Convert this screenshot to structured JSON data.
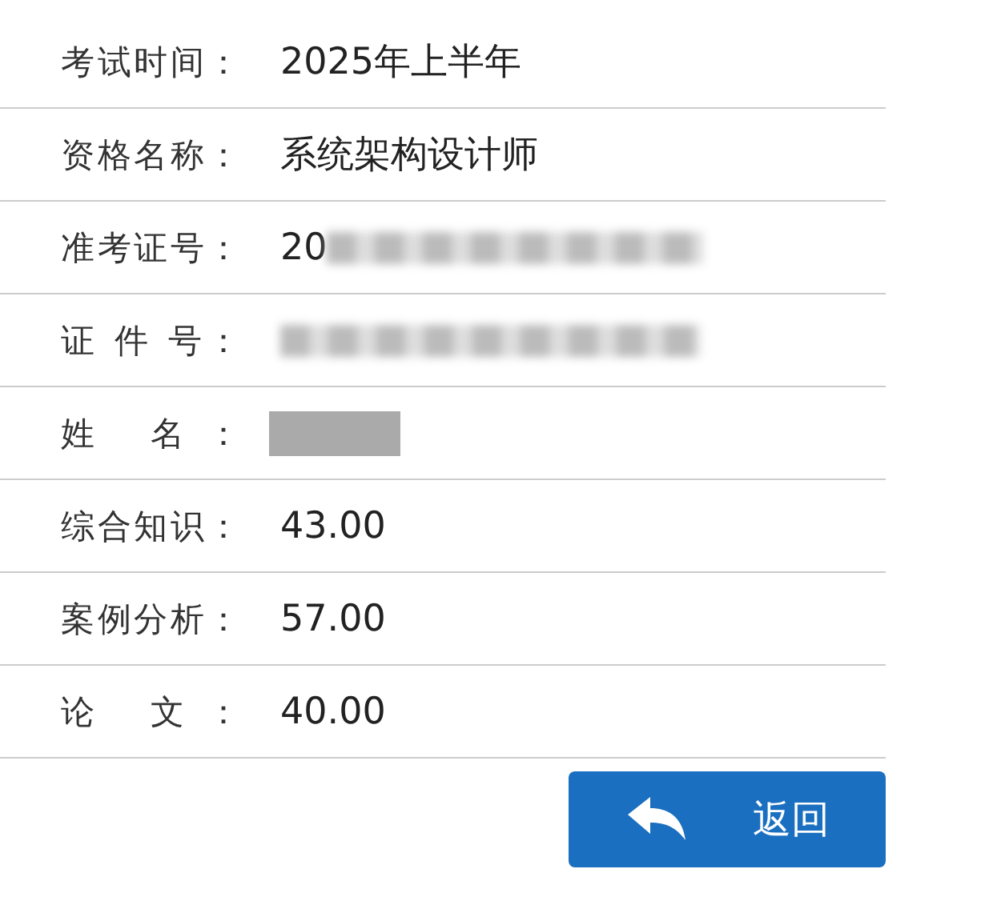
{
  "rows": [
    {
      "label": "考试时间：",
      "value": "2025年上半年"
    },
    {
      "label": "资格名称：",
      "value": "系统架构设计师"
    },
    {
      "label": "准考证号：",
      "value": "20",
      "blurred": true
    },
    {
      "label": "证 件 号：",
      "blurred": true
    },
    {
      "label": "姓 名：",
      "masked": true
    },
    {
      "label": "综合知识：",
      "value": "43.00"
    },
    {
      "label": "案例分析：",
      "value": "57.00"
    },
    {
      "label": "论 文：",
      "value": "40.00"
    }
  ],
  "back_button": {
    "label": "返回"
  }
}
